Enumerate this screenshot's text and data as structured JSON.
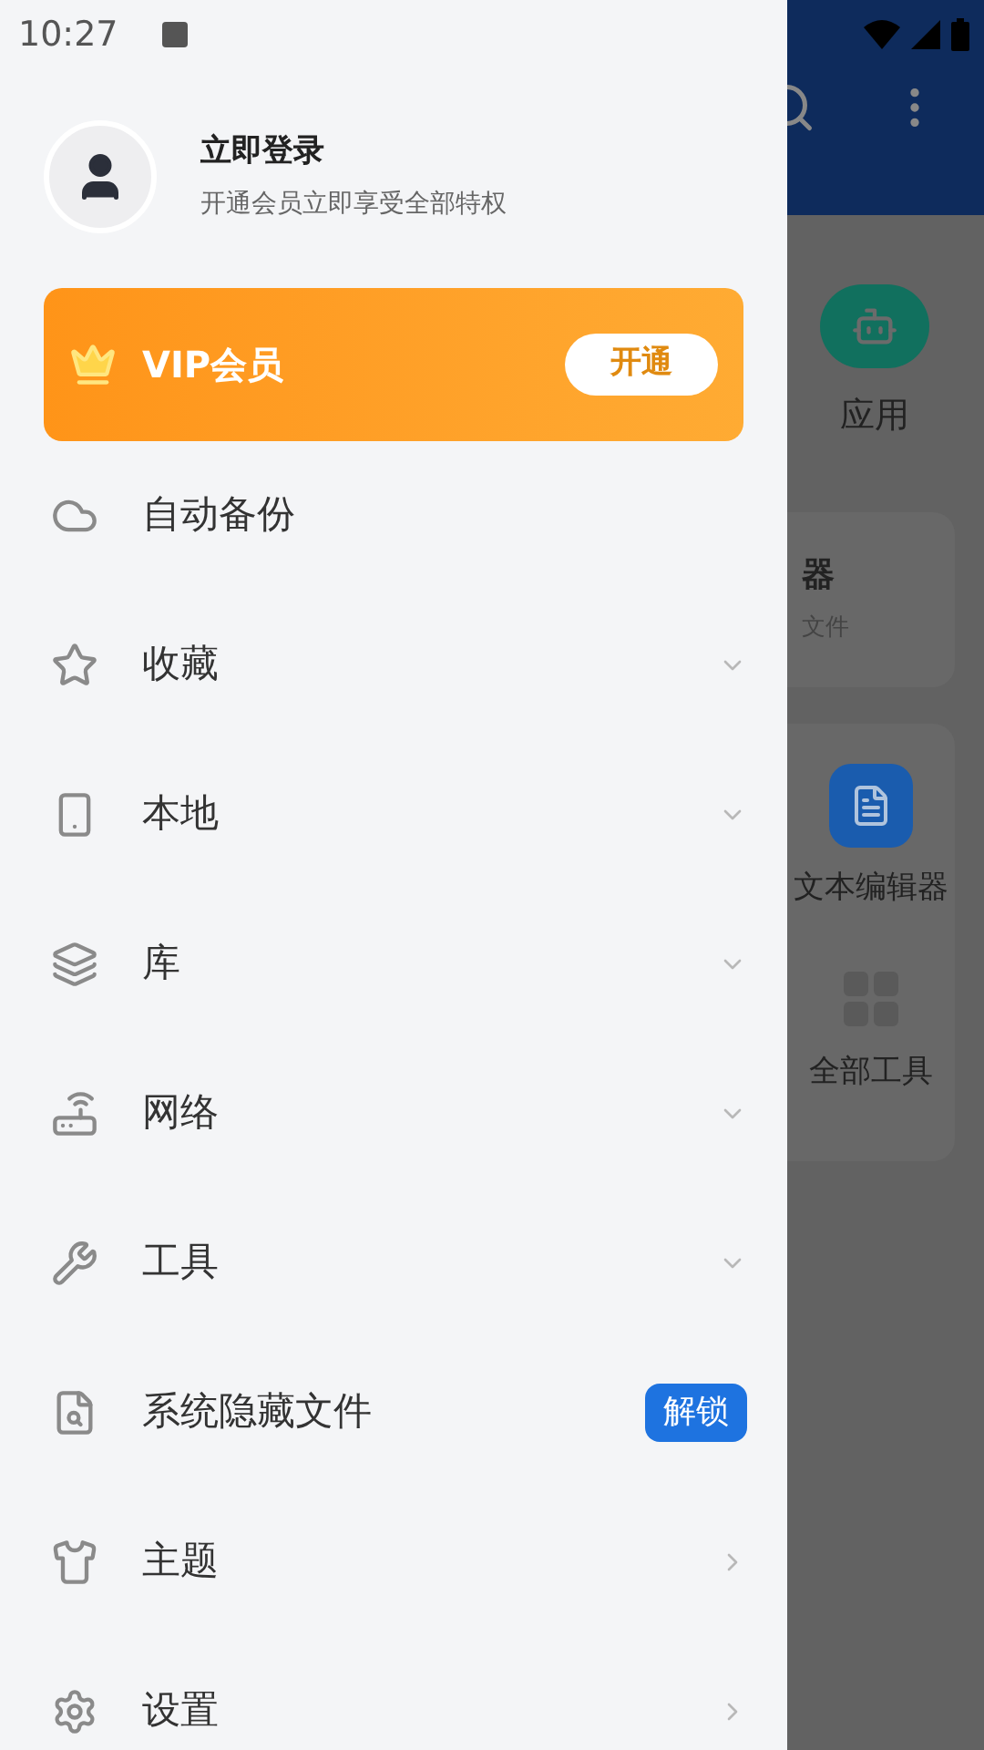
{
  "status_bar": {
    "time": "10:27"
  },
  "account": {
    "title": "立即登录",
    "subtitle": "开通会员立即享受全部特权"
  },
  "vip": {
    "title": "VIP会员",
    "button": "开通"
  },
  "menu": [
    {
      "label": "自动备份",
      "kind": "plain"
    },
    {
      "label": "收藏",
      "kind": "expandable"
    },
    {
      "label": "本地",
      "kind": "expandable"
    },
    {
      "label": "库",
      "kind": "expandable"
    },
    {
      "label": "网络",
      "kind": "expandable"
    },
    {
      "label": "工具",
      "kind": "expandable"
    },
    {
      "label": "系统隐藏文件",
      "kind": "badge",
      "badge": "解锁"
    },
    {
      "label": "主题",
      "kind": "link"
    },
    {
      "label": "设置",
      "kind": "link"
    }
  ],
  "background_app": {
    "app_label": "应用",
    "card_title": "器",
    "card_subtitle": "文件",
    "tools": [
      "文本编辑器",
      "全部工具"
    ]
  }
}
